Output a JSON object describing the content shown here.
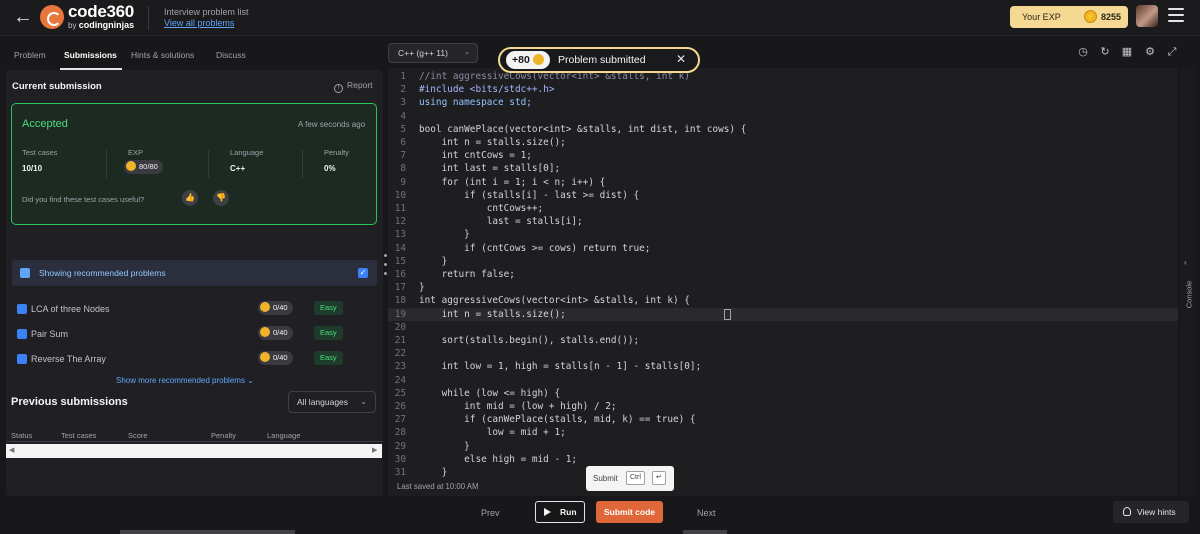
{
  "header": {
    "logo_text": "code360",
    "logo_sub_prefix": "by",
    "logo_sub_brand": "codingninjas",
    "crumb_title": "Interview problem list",
    "crumb_link": "View all problems",
    "exp_label": "Your EXP",
    "exp_value": "8255"
  },
  "left_tabs": [
    "Problem",
    "Submissions",
    "Hints & solutions",
    "Discuss"
  ],
  "current_submission": {
    "title": "Current submission",
    "report": "Report",
    "status": "Accepted",
    "time": "A few seconds ago",
    "stats": [
      {
        "label": "Test cases",
        "value": "10/10"
      },
      {
        "label": "EXP",
        "value": "80/80"
      },
      {
        "label": "Language",
        "value": "C++"
      },
      {
        "label": "Penalty",
        "value": "0%"
      }
    ],
    "useful_question": "Did you find these test cases useful?"
  },
  "recommended": {
    "header": "Showing recommended problems",
    "items": [
      {
        "name": "LCA of three Nodes",
        "score": "0/40",
        "difficulty": "Easy"
      },
      {
        "name": "Pair Sum",
        "score": "0/40",
        "difficulty": "Easy"
      },
      {
        "name": "Reverse The Array",
        "score": "0/40",
        "difficulty": "Easy"
      }
    ],
    "show_more": "Show more recommended problems"
  },
  "previous": {
    "title": "Previous submissions",
    "language_filter": "All languages",
    "columns": [
      "Status",
      "Test cases",
      "Score",
      "Penalty",
      "Language"
    ]
  },
  "editor": {
    "language": "C++ (g++ 11)",
    "last_saved": "Last saved at 10:00 AM",
    "lines": [
      {
        "n": "1",
        "t": "//int aggressiveCows(vector<int> &stalls, int k)",
        "c": "comment"
      },
      {
        "n": "2",
        "t": "#include <bits/stdc++.h>",
        "c": "pre"
      },
      {
        "n": "3",
        "t": "using namespace std;",
        "c": "kw"
      },
      {
        "n": "4",
        "t": "",
        "c": ""
      },
      {
        "n": "5",
        "t": "bool canWePlace(vector<int> &stalls, int dist, int cows) {",
        "c": ""
      },
      {
        "n": "6",
        "t": "    int n = stalls.size();",
        "c": ""
      },
      {
        "n": "7",
        "t": "    int cntCows = 1;",
        "c": ""
      },
      {
        "n": "8",
        "t": "    int last = stalls[0];",
        "c": ""
      },
      {
        "n": "9",
        "t": "    for (int i = 1; i < n; i++) {",
        "c": ""
      },
      {
        "n": "10",
        "t": "        if (stalls[i] - last >= dist) {",
        "c": ""
      },
      {
        "n": "11",
        "t": "            cntCows++;",
        "c": ""
      },
      {
        "n": "12",
        "t": "            last = stalls[i];",
        "c": ""
      },
      {
        "n": "13",
        "t": "        }",
        "c": ""
      },
      {
        "n": "14",
        "t": "        if (cntCows >= cows) return true;",
        "c": ""
      },
      {
        "n": "15",
        "t": "    }",
        "c": ""
      },
      {
        "n": "16",
        "t": "    return false;",
        "c": ""
      },
      {
        "n": "17",
        "t": "}",
        "c": ""
      },
      {
        "n": "18",
        "t": "int aggressiveCows(vector<int> &stalls, int k) {",
        "c": ""
      },
      {
        "n": "19",
        "t": "    int n = stalls.size();",
        "c": "hl"
      },
      {
        "n": "20",
        "t": "",
        "c": ""
      },
      {
        "n": "21",
        "t": "    sort(stalls.begin(), stalls.end());",
        "c": ""
      },
      {
        "n": "22",
        "t": "",
        "c": ""
      },
      {
        "n": "23",
        "t": "    int low = 1, high = stalls[n - 1] - stalls[0];",
        "c": ""
      },
      {
        "n": "24",
        "t": "",
        "c": ""
      },
      {
        "n": "25",
        "t": "    while (low <= high) {",
        "c": ""
      },
      {
        "n": "26",
        "t": "        int mid = (low + high) / 2;",
        "c": ""
      },
      {
        "n": "27",
        "t": "        if (canWePlace(stalls, mid, k) == true) {",
        "c": ""
      },
      {
        "n": "28",
        "t": "            low = mid + 1;",
        "c": ""
      },
      {
        "n": "29",
        "t": "        }",
        "c": ""
      },
      {
        "n": "30",
        "t": "        else high = mid - 1;",
        "c": ""
      },
      {
        "n": "31",
        "t": "    }",
        "c": ""
      }
    ]
  },
  "toast": {
    "badge": "+80",
    "message": "Problem submitted"
  },
  "submit_tip": {
    "label": "Submit",
    "key1": "Ctrl",
    "key2": "↵"
  },
  "console_label": "Console",
  "bottom": {
    "prev": "Prev",
    "run": "Run",
    "submit": "Submit code",
    "next": "Next",
    "hints": "View hints"
  },
  "colors": {
    "accepted": "#4ade80",
    "submit": "#e0673a",
    "exp_pill": "#f5d993",
    "link": "#60a5fa"
  }
}
